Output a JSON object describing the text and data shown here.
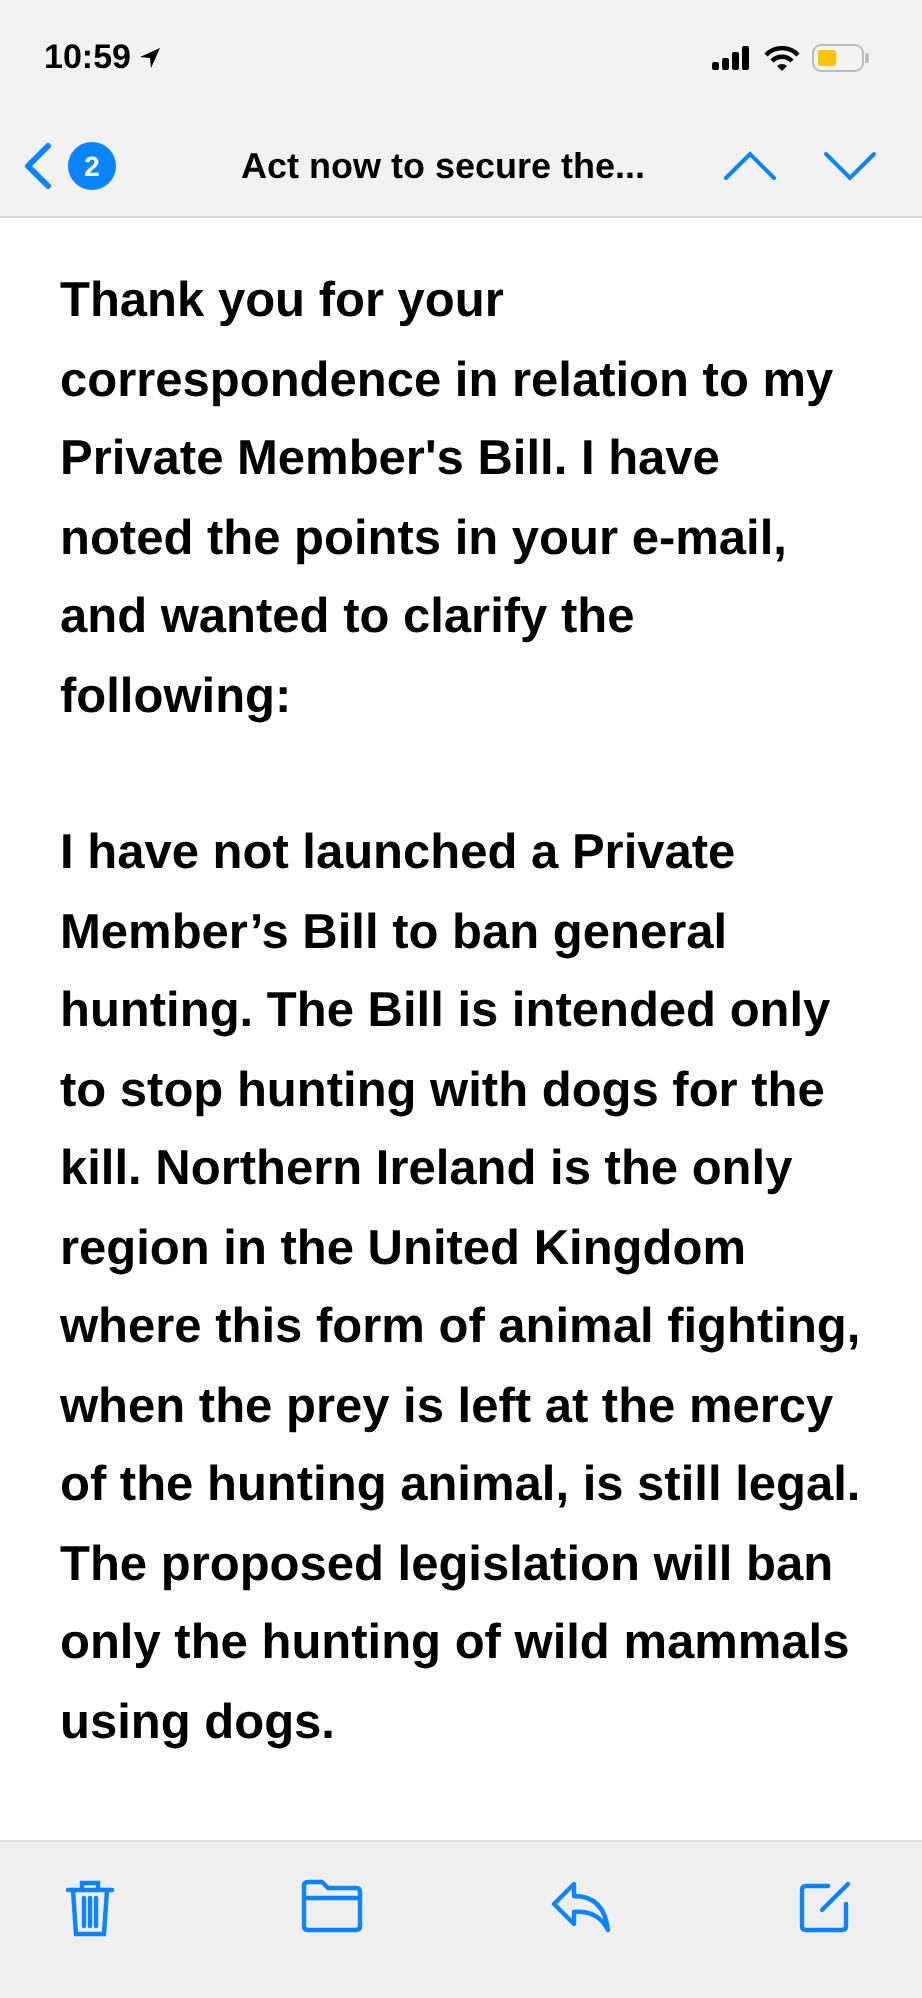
{
  "status_bar": {
    "time": "10:59"
  },
  "nav_bar": {
    "badge": "2",
    "title": "Act now to secure the..."
  },
  "message": {
    "paragraphs": [
      "Thank you for your correspondence in relation to my Private Member's Bill. I have noted the points in your e-mail, and wanted to clarify the following:",
      "I have not launched a Private Member’s Bill to ban general hunting. The Bill is intended only to stop hunting with dogs for the kill. Northern Ireland is the only region in the United Kingdom where this form of animal fighting, when the prey is left at the mercy of the hunting animal, is still legal. The proposed legislation will ban only the hunting of wild mammals using dogs."
    ]
  }
}
